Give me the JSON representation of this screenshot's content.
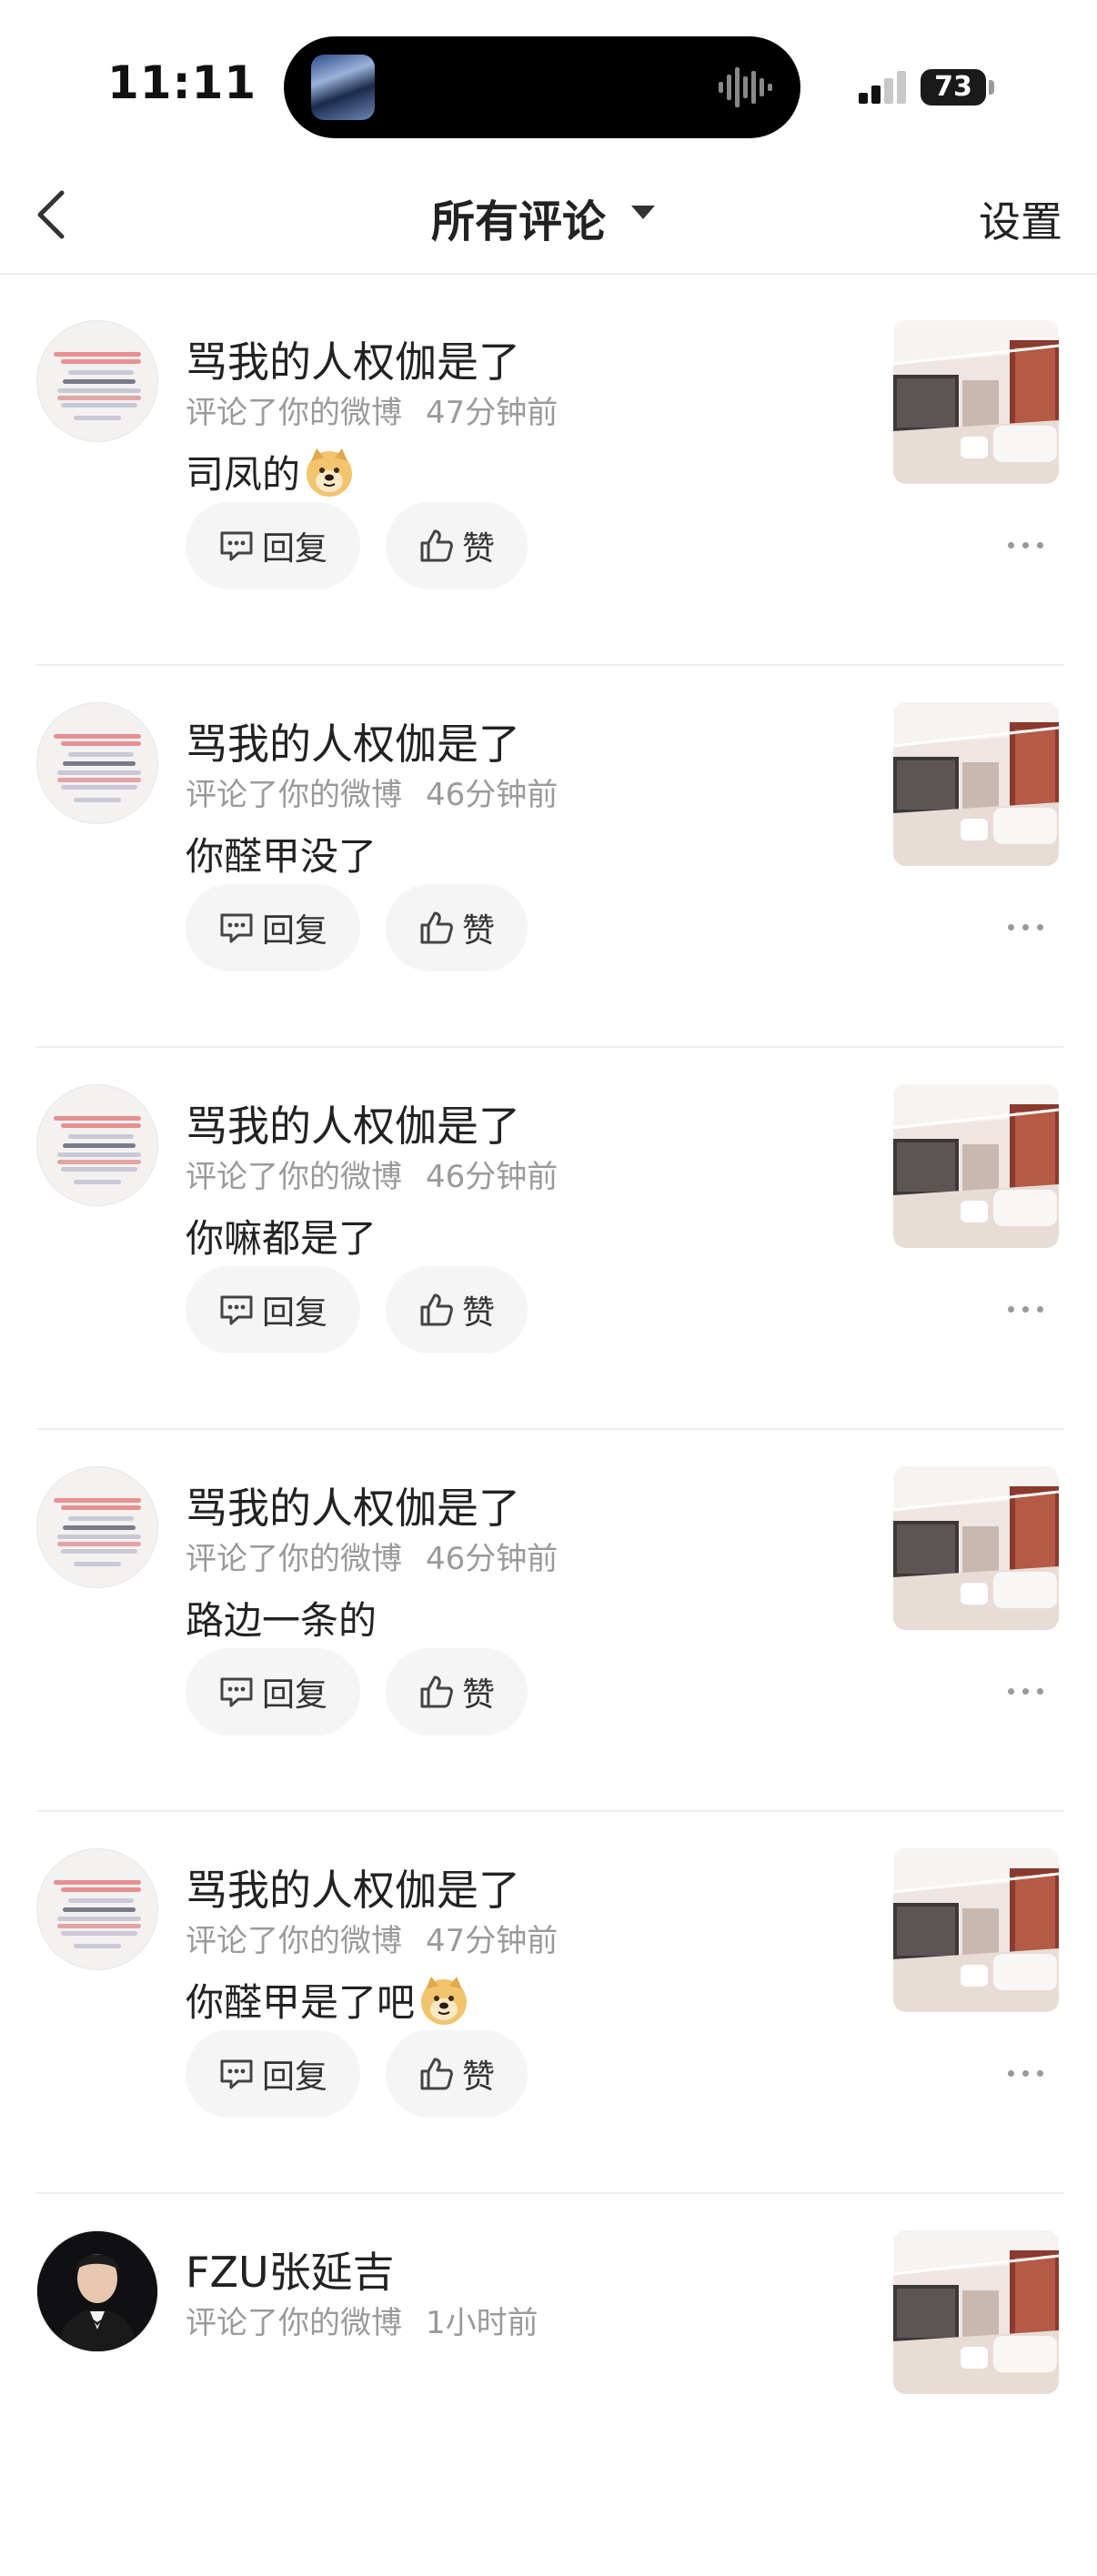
{
  "status_bar": {
    "time": "11:11",
    "battery": "73"
  },
  "nav": {
    "title": "所有评论",
    "settings": "设置",
    "back_icon": "chevron-left-icon",
    "dropdown_icon": "caret-down-icon"
  },
  "actions": {
    "reply": "回复",
    "like": "赞"
  },
  "comments": [
    {
      "name": "骂我的人权伽是了",
      "action": "评论了你的微博",
      "time": "47分钟前",
      "text": "司凤的",
      "emoji": "doge-emoji",
      "avatar": "text-screenshot"
    },
    {
      "name": "骂我的人权伽是了",
      "action": "评论了你的微博",
      "time": "46分钟前",
      "text": "你醛甲没了",
      "emoji": "",
      "avatar": "text-screenshot"
    },
    {
      "name": "骂我的人权伽是了",
      "action": "评论了你的微博",
      "time": "46分钟前",
      "text": "你嘛都是了",
      "emoji": "",
      "avatar": "text-screenshot"
    },
    {
      "name": "骂我的人权伽是了",
      "action": "评论了你的微博",
      "time": "46分钟前",
      "text": "路边一条的",
      "emoji": "",
      "avatar": "text-screenshot"
    },
    {
      "name": "骂我的人权伽是了",
      "action": "评论了你的微博",
      "time": "47分钟前",
      "text": "你醛甲是了吧",
      "emoji": "doge-emoji",
      "avatar": "text-screenshot"
    },
    {
      "name": "FZU张延吉",
      "action": "评论了你的微博",
      "time": "1小时前",
      "text": "",
      "emoji": "",
      "avatar": "portrait"
    }
  ],
  "colors": {
    "background": "#ffffff",
    "button_bg": "#f5f5f5",
    "meta_text": "#9a9a9a",
    "divider": "#eeeeee"
  }
}
